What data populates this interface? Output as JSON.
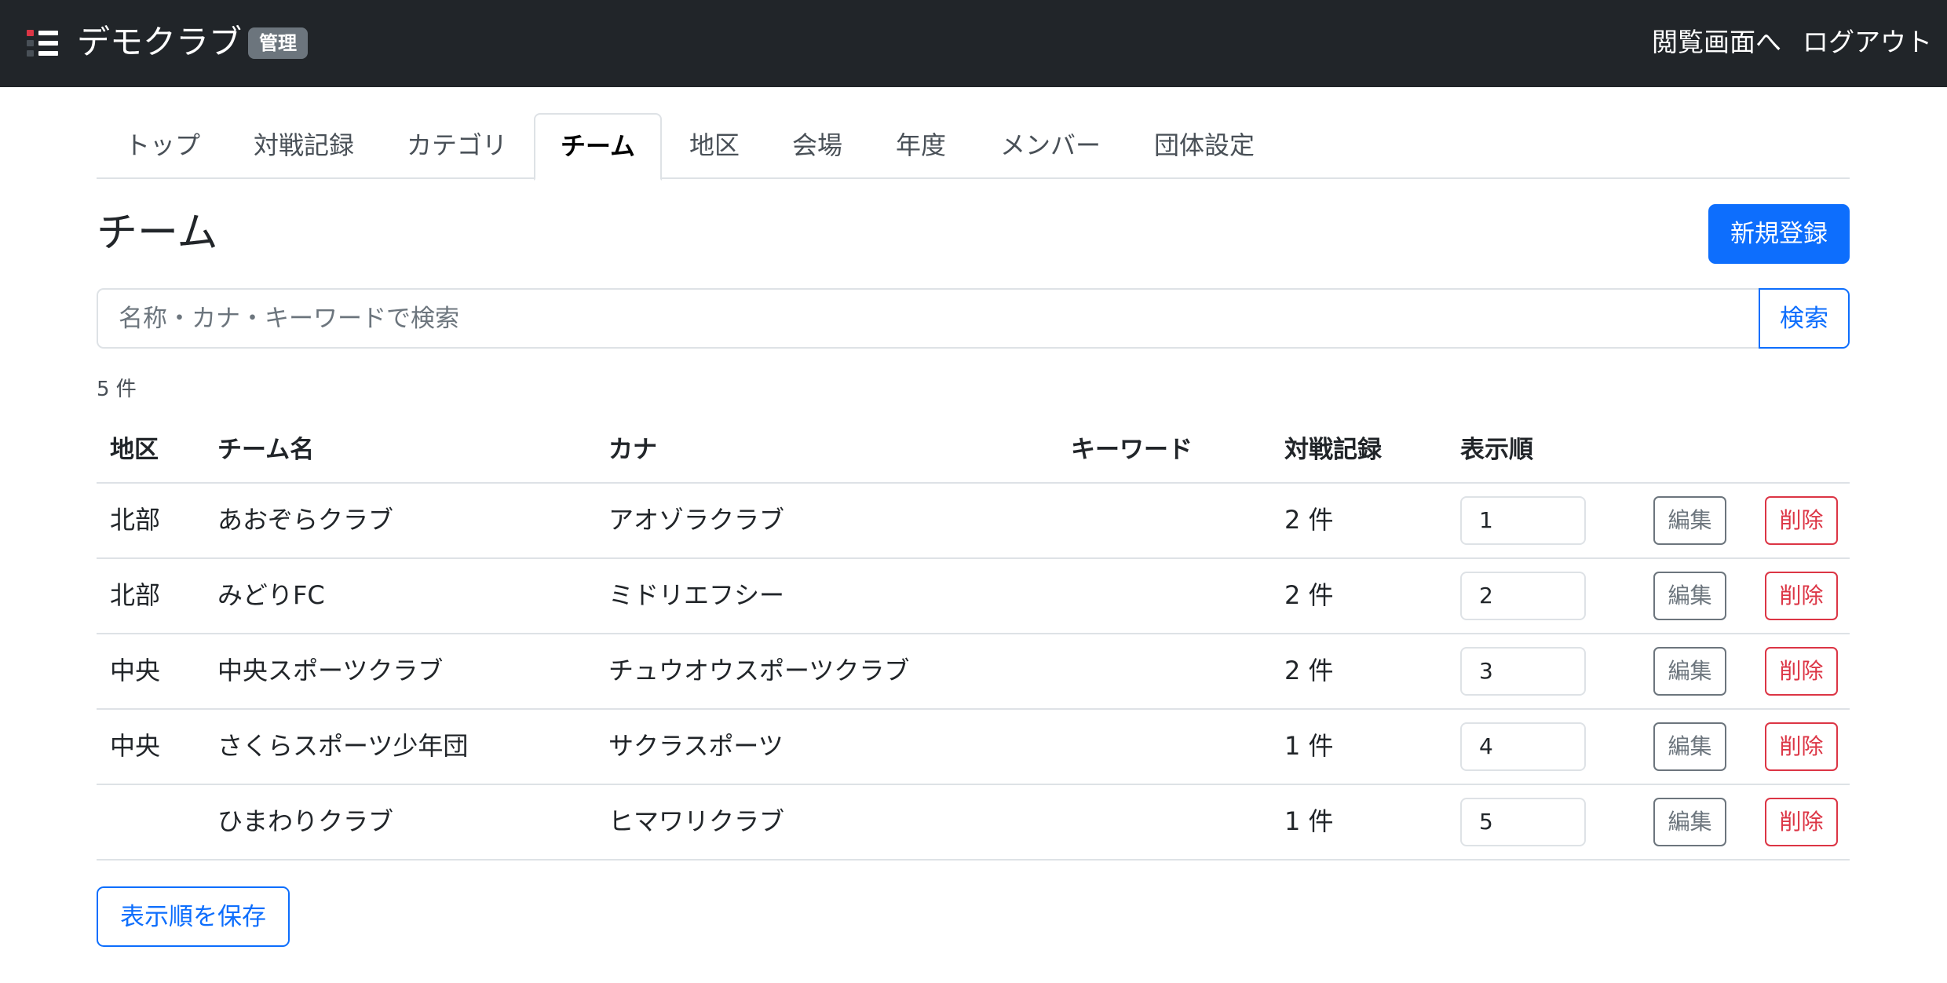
{
  "navbar": {
    "brand": "デモクラブ",
    "badge": "管理",
    "view_link": "閲覧画面へ",
    "logout_link": "ログアウト",
    "colors": {
      "background": "#212529",
      "badge": "#6c757d"
    }
  },
  "tabs": [
    {
      "label": "トップ"
    },
    {
      "label": "対戦記録"
    },
    {
      "label": "カテゴリ"
    },
    {
      "label": "チーム",
      "active": true
    },
    {
      "label": "地区"
    },
    {
      "label": "会場"
    },
    {
      "label": "年度"
    },
    {
      "label": "メンバー"
    },
    {
      "label": "団体設定"
    }
  ],
  "page": {
    "title": "チーム",
    "new_button": "新規登録"
  },
  "search": {
    "placeholder": "名称・カナ・キーワードで検索",
    "value": "",
    "button": "検索"
  },
  "result_count": "5 件",
  "table": {
    "headers": {
      "region": "地区",
      "name": "チーム名",
      "kana": "カナ",
      "keyword": "キーワード",
      "matches": "対戦記録",
      "order": "表示順"
    },
    "edit_label": "編集",
    "delete_label": "削除",
    "rows": [
      {
        "region": "北部",
        "name": "あおぞらクラブ",
        "kana": "アオゾラクラブ",
        "keyword": "",
        "matches": "2 件",
        "order": "1"
      },
      {
        "region": "北部",
        "name": "みどりFC",
        "kana": "ミドリエフシー",
        "keyword": "",
        "matches": "2 件",
        "order": "2"
      },
      {
        "region": "中央",
        "name": "中央スポーツクラブ",
        "kana": "チュウオウスポーツクラブ",
        "keyword": "",
        "matches": "2 件",
        "order": "3"
      },
      {
        "region": "中央",
        "name": "さくらスポーツ少年団",
        "kana": "サクラスポーツ",
        "keyword": "",
        "matches": "1 件",
        "order": "4"
      },
      {
        "region": "",
        "name": "ひまわりクラブ",
        "kana": "ヒマワリクラブ",
        "keyword": "",
        "matches": "1 件",
        "order": "5"
      }
    ]
  },
  "save_order_button": "表示順を保存",
  "theme": {
    "primary": "#0d6efd",
    "secondary": "#6c757d",
    "danger": "#dc3545",
    "border": "#dee2e6"
  },
  "icons": {
    "logo": "list-icon"
  }
}
